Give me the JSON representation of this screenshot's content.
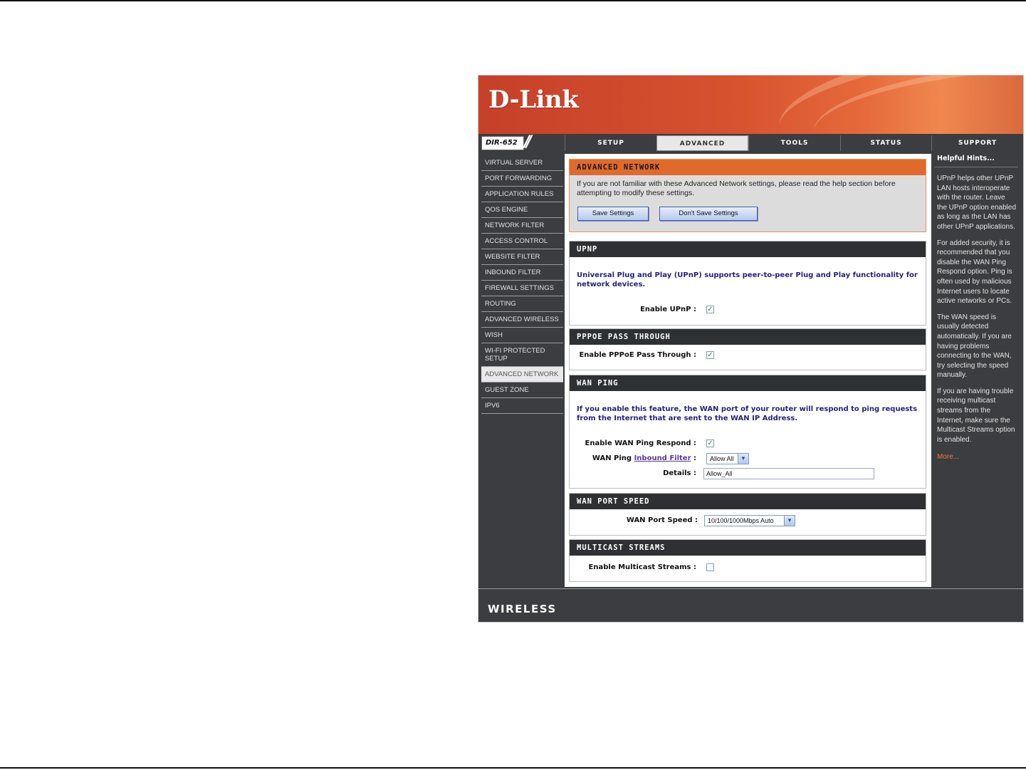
{
  "brand": {
    "logo": "D-Link",
    "model": "DIR-652",
    "footer": "WIRELESS"
  },
  "nav": {
    "tabs": [
      {
        "label": "SETUP"
      },
      {
        "label": "ADVANCED",
        "active": true
      },
      {
        "label": "TOOLS"
      },
      {
        "label": "STATUS"
      },
      {
        "label": "SUPPORT"
      }
    ]
  },
  "sidebar": {
    "items": [
      "VIRTUAL SERVER",
      "PORT FORWARDING",
      "APPLICATION RULES",
      "QOS ENGINE",
      "NETWORK FILTER",
      "ACCESS CONTROL",
      "WEBSITE FILTER",
      "INBOUND FILTER",
      "FIREWALL SETTINGS",
      "ROUTING",
      "ADVANCED WIRELESS",
      "WISH",
      "WI-FI PROTECTED SETUP",
      "ADVANCED NETWORK",
      "GUEST ZONE",
      "IPV6"
    ],
    "active": "ADVANCED NETWORK"
  },
  "advanced_network": {
    "title": "ADVANCED NETWORK",
    "description": "If you are not familiar with these Advanced Network settings, please read the help section before attempting to modify these settings.",
    "save_label": "Save Settings",
    "dont_save_label": "Don't Save Settings"
  },
  "upnp": {
    "title": "UPNP",
    "description": "Universal Plug and Play (UPnP) supports peer-to-peer Plug and Play functionality for network devices.",
    "enable_label": "Enable UPnP :",
    "enabled": true
  },
  "pppoe": {
    "title": "PPPOE PASS THROUGH",
    "enable_label": "Enable PPPoE Pass Through :",
    "enabled": true
  },
  "wan_ping": {
    "title": "WAN PING",
    "description": "If you enable this feature, the WAN port of your router will respond to ping requests from the Internet that are sent to the WAN IP Address.",
    "respond_label": "Enable WAN Ping Respond :",
    "respond_enabled": true,
    "filter_label_prefix": "WAN Ping",
    "filter_link": "Inbound Filter",
    "filter_label_suffix": ":",
    "filter_value": "Allow All",
    "details_label": "Details :",
    "details_value": "Allow_All"
  },
  "wan_port_speed": {
    "title": "WAN PORT SPEED",
    "label": "WAN Port Speed :",
    "value": "10/100/1000Mbps Auto"
  },
  "multicast": {
    "title": "MULTICAST STREAMS",
    "label": "Enable Multicast Streams :",
    "enabled": false
  },
  "help": {
    "title": "Helpful Hints...",
    "paragraphs": [
      "UPnP helps other UPnP LAN hosts interoperate with the router. Leave the UPnP option enabled as long as the LAN has other UPnP applications.",
      "For added security, it is recommended that you disable the WAN Ping Respond option. Ping is often used by malicious Internet users to locate active networks or PCs.",
      "The WAN speed is usually detected automatically. If you are having problems connecting to the WAN, try selecting the speed manually.",
      "If you are having trouble receiving multicast streams from the Internet, make sure the Multicast Streams option is enabled."
    ],
    "more": "More..."
  },
  "icons": {
    "checkbox_checked": "check-icon",
    "dropdown": "chevron-down-icon"
  },
  "colors": {
    "brand_orange": "#e06a2c",
    "nav_dark": "#3b3d40",
    "link_blue": "#25237d"
  }
}
